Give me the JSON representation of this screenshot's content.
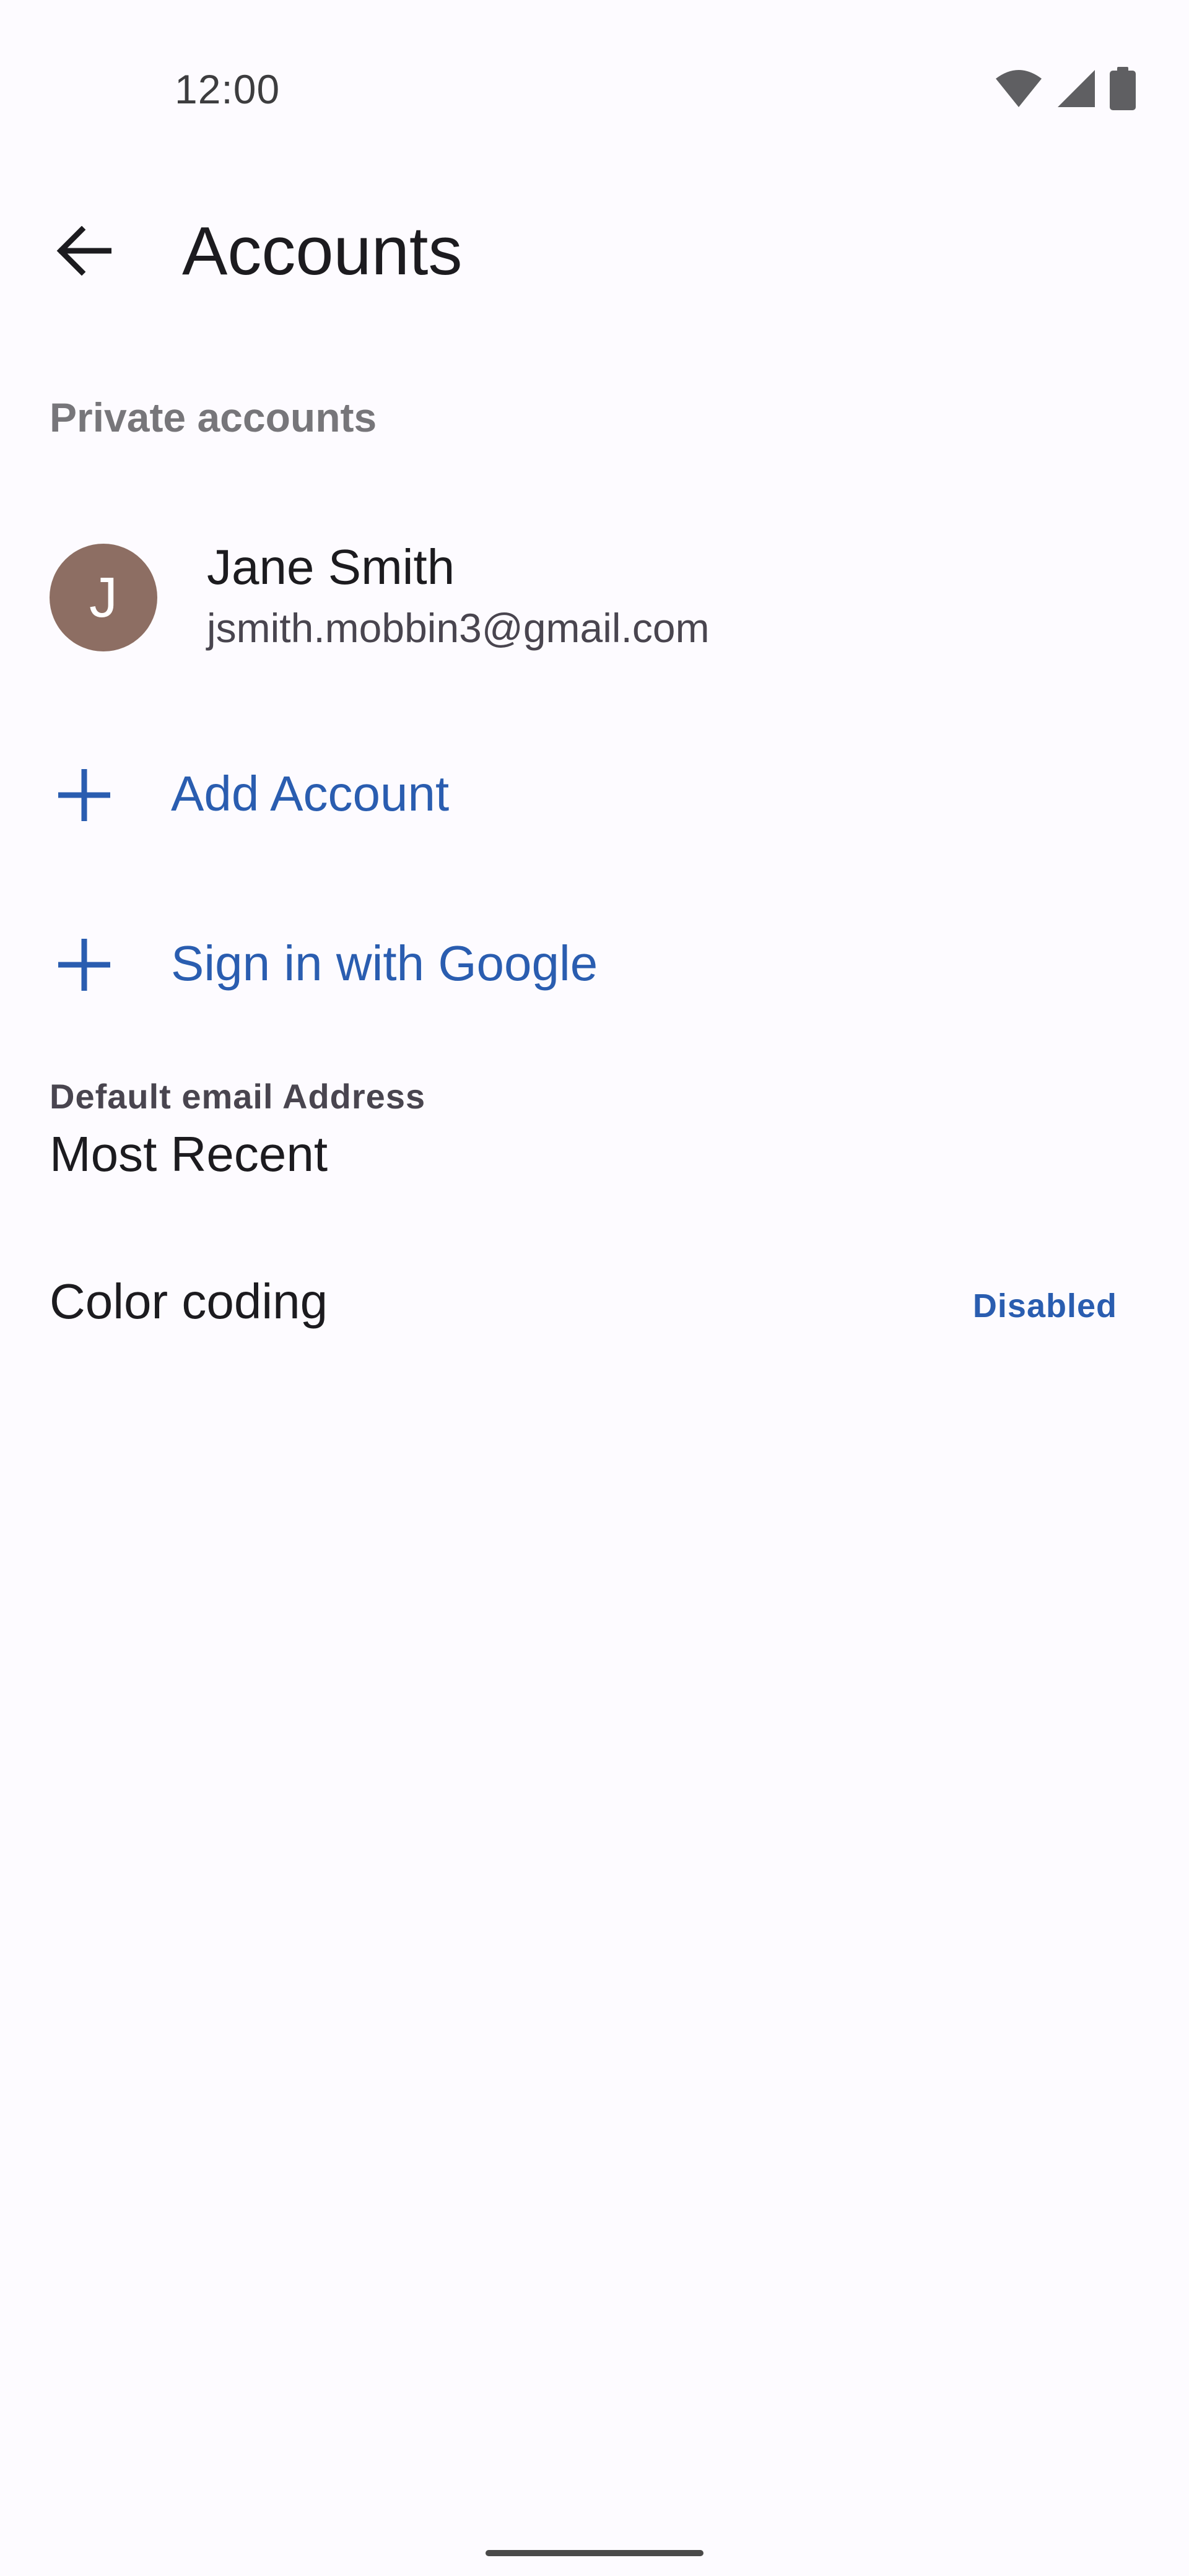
{
  "status_bar": {
    "time": "12:00",
    "icons": [
      "wifi-icon",
      "cell-signal-icon",
      "battery-icon"
    ]
  },
  "app_bar": {
    "back_icon": "arrow-back-icon",
    "title": "Accounts"
  },
  "private_accounts": {
    "header": "Private accounts",
    "accounts": [
      {
        "avatar_initial": "J",
        "avatar_color": "#8d6e63",
        "name": "Jane Smith",
        "email": "jsmith.mobbin3@gmail.com"
      }
    ]
  },
  "actions": {
    "add_account": {
      "icon": "plus-icon",
      "label": "Add Account"
    },
    "sign_in_google": {
      "icon": "plus-icon",
      "label": "Sign in with Google"
    }
  },
  "preferences": {
    "default_email": {
      "caption": "Default email Address",
      "value": "Most Recent"
    },
    "color_coding": {
      "title": "Color coding",
      "status": "Disabled"
    }
  },
  "colors": {
    "background": "#fdfbff",
    "accent": "#2a5db0",
    "secondary_text": "#77767a"
  }
}
